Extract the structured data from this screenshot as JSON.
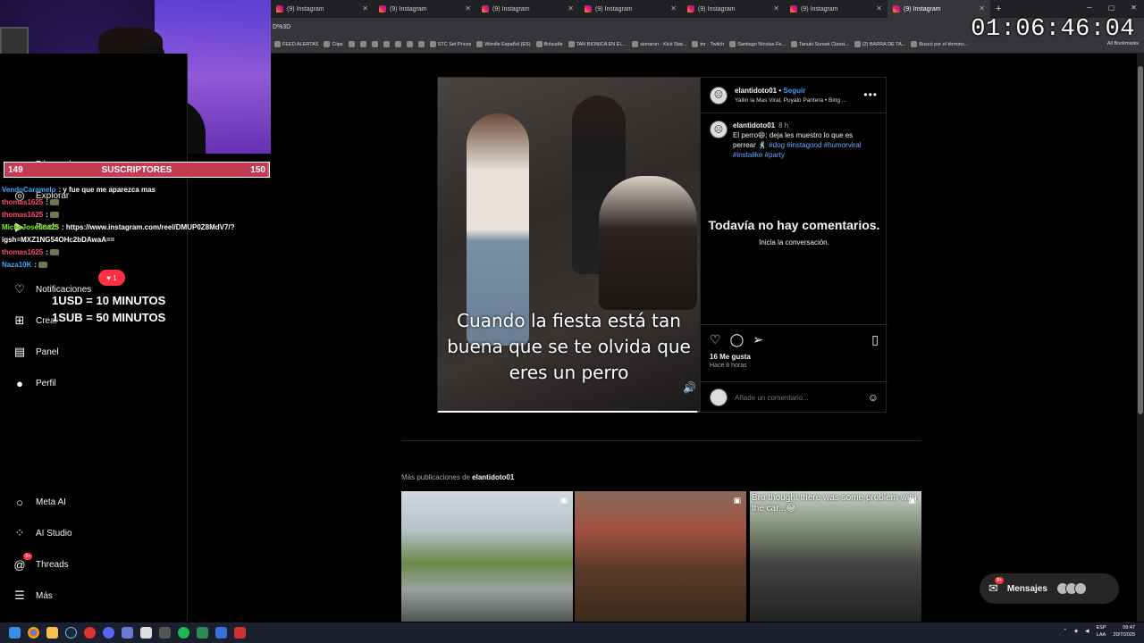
{
  "browser": {
    "tabs": [
      {
        "label": "(9) Instagram",
        "active": false
      },
      {
        "label": "(9) Instagram",
        "active": false
      },
      {
        "label": "(9) Instagram",
        "active": false
      },
      {
        "label": "(9) Instagram",
        "active": false
      },
      {
        "label": "(9) Instagram",
        "active": false
      },
      {
        "label": "(9) Instagram",
        "active": false
      },
      {
        "label": "(9) Instagram",
        "active": true
      }
    ],
    "new_tab_symbol": "+",
    "url_fragment": "D%3D",
    "bookmarks": [
      "FEED ALERTAS",
      "Clips",
      "",
      "",
      "",
      "",
      "",
      "",
      "",
      "STC Set Prices",
      "Wordle Español (ES)",
      "Bolsudle",
      "TAN BIONICA EN EL...",
      "sionaron - Kick Stat...",
      "tnr - Twitch",
      "Santiago Nicolas Fe...",
      "Tanuki Sunset Classi...",
      "(2) BARRA DE TA...",
      "Buscó por el término..."
    ],
    "all_bookmarks": "All Bookmarks"
  },
  "stream": {
    "timer": "01:06:46:04",
    "subs_current": "149",
    "subs_label": "SUSCRIPTORES",
    "subs_goal": "150",
    "subs_progress": 0.993,
    "rate_line1": "1USD = 10 MINUTOS",
    "rate_line2": "1SUB = 50 MINUTOS",
    "heart_count": "1",
    "chat": [
      {
        "user": "",
        "msg": "",
        "color": "#ff4d6d"
      },
      {
        "user": "VendoCaramelo",
        "msg": ": y fue que me aparezca mas",
        "color": "#3fa9ff"
      },
      {
        "user": "thomas1625",
        "msg": ":",
        "color": "#ff4d6d"
      },
      {
        "user": "thomas1625",
        "msg": ":",
        "color": "#ff4d6d"
      },
      {
        "user": "MicheJosefina25",
        "msg": ": https://www.instagram.com/reel/DMUP0Z8MdV7/?",
        "color": "#7cfc00"
      },
      {
        "user": "",
        "msg": "igsh=MXZ1NG54OHc2bDAwaA==",
        "color": "#ffffff"
      },
      {
        "user": "thomas1625",
        "msg": ":",
        "color": "#ff4d6d"
      },
      {
        "user": "Naza10K",
        "msg": ":",
        "color": "#3fa9ff"
      }
    ]
  },
  "sidebar": {
    "items": [
      {
        "label": "Búsqueda",
        "icon": "search-icon",
        "glyph": "⌕"
      },
      {
        "label": "Explorar",
        "icon": "compass-icon",
        "glyph": "◎"
      },
      {
        "label": "Reels",
        "icon": "reels-icon",
        "glyph": "▶"
      },
      {
        "label": "Notificaciones",
        "icon": "heart-icon",
        "glyph": "♡"
      },
      {
        "label": "Crear",
        "icon": "plus-icon",
        "glyph": "⊞"
      },
      {
        "label": "Panel",
        "icon": "chart-icon",
        "glyph": "▤"
      },
      {
        "label": "Perfil",
        "icon": "profile-avatar-icon",
        "glyph": "●"
      }
    ],
    "bottom_items": [
      {
        "label": "Meta AI",
        "icon": "meta-ai-icon",
        "glyph": "○"
      },
      {
        "label": "AI Studio",
        "icon": "ai-studio-icon",
        "glyph": "⁘"
      },
      {
        "label": "Threads",
        "icon": "threads-icon",
        "glyph": "@",
        "badge": "9+"
      },
      {
        "label": "Más",
        "icon": "menu-icon",
        "glyph": "☰"
      }
    ]
  },
  "post": {
    "username": "elantidoto01",
    "follow_label": "Seguir",
    "separator": "•",
    "music": "Yailin la Mas Viral, Puyalo Pantera • Bing ...",
    "comment_time": "8 h",
    "caption_text": "El perro😆: deja les muestro lo que es perrear 🕺",
    "hashtags": [
      "#dog",
      "#instagood",
      "#humorviral",
      "#instalike",
      "#party"
    ],
    "video_caption": "Cuando la fiesta está tan buena que se te olvida que eres un perro",
    "video_progress": 0.99,
    "no_comments_title": "Todavía no hay comentarios.",
    "no_comments_sub": "Inicia la conversación.",
    "likes": "16 Me gusta",
    "posted_ago": "Hace 8 horas",
    "comment_placeholder": "Añade un comentario..."
  },
  "more_posts": {
    "title_prefix": "Más publicaciones de",
    "username": "elantidoto01",
    "third_caption": "Bro thought there was some problem with the car...😂"
  },
  "messages": {
    "label": "Mensajes",
    "badge": "9+"
  },
  "taskbar": {
    "lang": "ESP",
    "lang2": "LAA",
    "time": "09:47",
    "date": "20/7/2025"
  }
}
